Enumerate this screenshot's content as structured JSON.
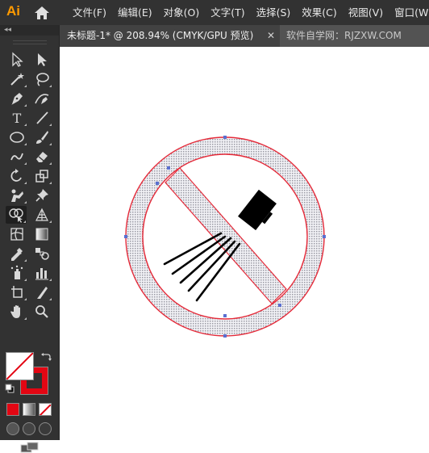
{
  "app": {
    "logo": "Ai"
  },
  "menu": {
    "items": [
      "文件(F)",
      "编辑(E)",
      "对象(O)",
      "文字(T)",
      "选择(S)",
      "效果(C)",
      "视图(V)",
      "窗口(W)"
    ]
  },
  "tab": {
    "title": "未标题-1* @ 208.94% (CMYK/GPU 预览)",
    "close_label": "✕",
    "watermark": "软件自学网：RJZXW.COM"
  },
  "toolbar": {
    "collapse_label": "◂◂",
    "tools": [
      "selection-tool",
      "direct-selection-tool",
      "magic-wand-tool",
      "lasso-tool",
      "pen-tool",
      "curvature-tool",
      "type-tool",
      "line-segment-tool",
      "ellipse-tool",
      "paintbrush-tool",
      "shaper-tool",
      "eraser-tool",
      "rotate-tool",
      "scale-tool",
      "puppet-warp-tool",
      "pin-tool",
      "shape-builder-tool",
      "perspective-grid-tool",
      "mesh-tool",
      "gradient-tool",
      "eyedropper-tool",
      "blend-tool",
      "symbol-sprayer-tool",
      "column-graph-tool",
      "artboard-tool",
      "slice-tool",
      "hand-tool",
      "zoom-tool"
    ],
    "active_tool": "shape-builder-tool",
    "type_tool_glyph": "T"
  },
  "colors": {
    "fill": "#ffffff",
    "stroke": "#e30613",
    "sign_ring": "#e8e8ec",
    "sign_outline": "#e52b3a",
    "brush_head": "#000000",
    "ui_dark": "#323232",
    "accent_logo": "#ff9a00"
  }
}
